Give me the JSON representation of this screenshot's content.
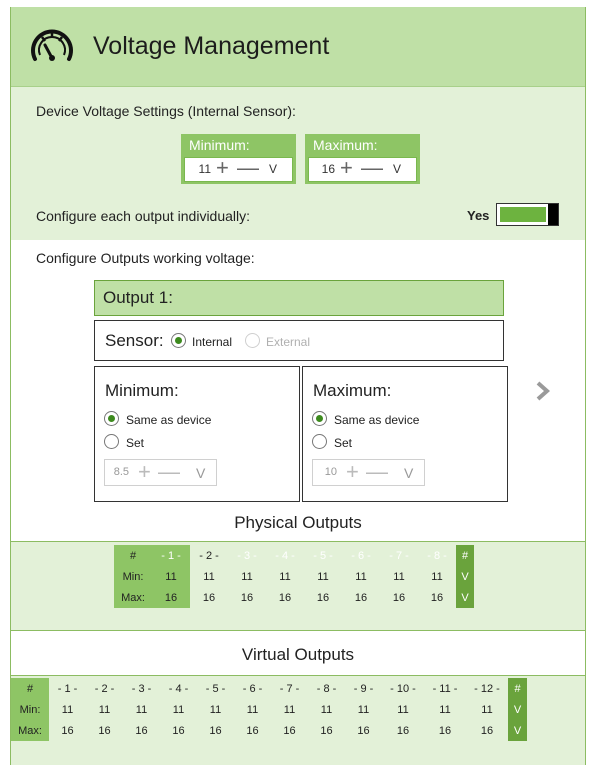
{
  "header": {
    "title": "Voltage Management",
    "icon": "gauge-icon"
  },
  "device": {
    "label": "Device Voltage Settings (Internal Sensor):",
    "minimum": {
      "caption": "Minimum:",
      "value": "11",
      "plus": "+",
      "minus": "—",
      "unit": "V"
    },
    "maximum": {
      "caption": "Maximum:",
      "value": "16",
      "plus": "+",
      "minus": "—",
      "unit": "V"
    },
    "configure_label": "Configure each output individually:",
    "configure_value": "Yes",
    "toggle_on": true
  },
  "outputs": {
    "label": "Configure Outputs working voltage:",
    "current_output": "Output 1:",
    "sensor": {
      "label": "Sensor:",
      "options": [
        "Internal",
        "External"
      ],
      "selected": "Internal"
    },
    "minimum": {
      "heading": "Minimum:",
      "option_same": "Same as device",
      "option_set": "Set",
      "selected": "Same as device",
      "value": "8.5",
      "plus": "+",
      "minus": "—",
      "unit": "V"
    },
    "maximum": {
      "heading": "Maximum:",
      "option_same": "Same as device",
      "option_set": "Set",
      "selected": "Same as device",
      "value": "10",
      "plus": "+",
      "minus": "—",
      "unit": "V"
    },
    "next_arrow": "›"
  },
  "physical": {
    "title": "Physical Outputs",
    "headers": [
      "#",
      "- 1 -",
      "- 2 -",
      "- 3 -",
      "- 4 -",
      "- 5 -",
      "- 6 -",
      "- 7 -",
      "- 8 -",
      "#"
    ],
    "min_label": "Min:",
    "max_label": "Max:",
    "unit": "V",
    "min": [
      "11",
      "11",
      "11",
      "11",
      "11",
      "11",
      "11",
      "11"
    ],
    "max": [
      "16",
      "16",
      "16",
      "16",
      "16",
      "16",
      "16",
      "16"
    ]
  },
  "virtual": {
    "title": "Virtual Outputs",
    "headers": [
      "#",
      "- 1 -",
      "- 2 -",
      "- 3 -",
      "- 4 -",
      "- 5 -",
      "- 6 -",
      "- 7 -",
      "- 8 -",
      "- 9 -",
      "- 10 -",
      "- 11 -",
      "- 12 -",
      "#"
    ],
    "min_label": "Min:",
    "max_label": "Max:",
    "unit": "V",
    "min": [
      "11",
      "11",
      "11",
      "11",
      "11",
      "11",
      "11",
      "11",
      "11",
      "11",
      "11",
      "11"
    ],
    "max": [
      "16",
      "16",
      "16",
      "16",
      "16",
      "16",
      "16",
      "16",
      "16",
      "16",
      "16",
      "16"
    ]
  },
  "colors": {
    "header_bg": "#bfe0a6",
    "panel_bg": "#e3f1d8",
    "accent": "#8ec565",
    "dark_accent": "#6aa33c",
    "toggle_fill": "#6db33f"
  }
}
